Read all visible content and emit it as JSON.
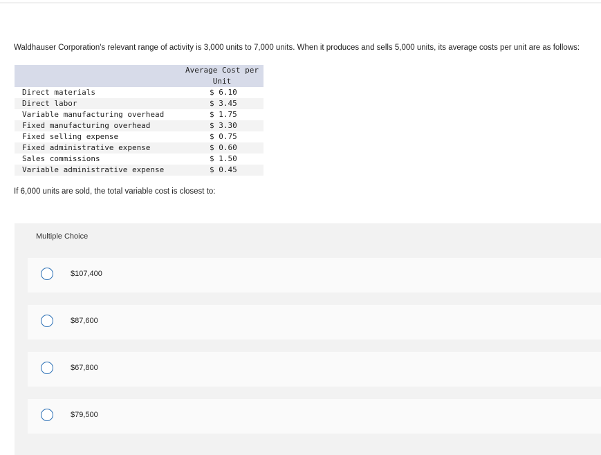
{
  "question": {
    "text": "Waldhauser Corporation's relevant range of activity is 3,000 units to 7,000 units. When it produces and sells 5,000 units, its average costs per unit are as follows:"
  },
  "cost_table": {
    "header_item": "",
    "header_cost_line1": "Average Cost per",
    "header_cost_line2": "Unit",
    "rows": [
      {
        "item": "Direct materials",
        "cost": "$ 6.10"
      },
      {
        "item": "Direct labor",
        "cost": "$ 3.45"
      },
      {
        "item": "Variable manufacturing overhead",
        "cost": "$ 1.75"
      },
      {
        "item": "Fixed manufacturing overhead",
        "cost": "$ 3.30"
      },
      {
        "item": "Fixed selling expense",
        "cost": "$ 0.75"
      },
      {
        "item": "Fixed administrative expense",
        "cost": "$ 0.60"
      },
      {
        "item": "Sales commissions",
        "cost": "$ 1.50"
      },
      {
        "item": "Variable administrative expense",
        "cost": "$ 0.45"
      }
    ]
  },
  "prompt": "If 6,000 units are sold, the total variable cost is closest to:",
  "multiple_choice": {
    "label": "Multiple Choice",
    "options": [
      {
        "text": "$107,400"
      },
      {
        "text": "$87,600"
      },
      {
        "text": "$67,800"
      },
      {
        "text": "$79,500"
      }
    ]
  },
  "colors": {
    "table_header_bg": "#d7dbe9",
    "radio_border": "#2a6fb5",
    "panel_bg": "#f2f2f2"
  }
}
